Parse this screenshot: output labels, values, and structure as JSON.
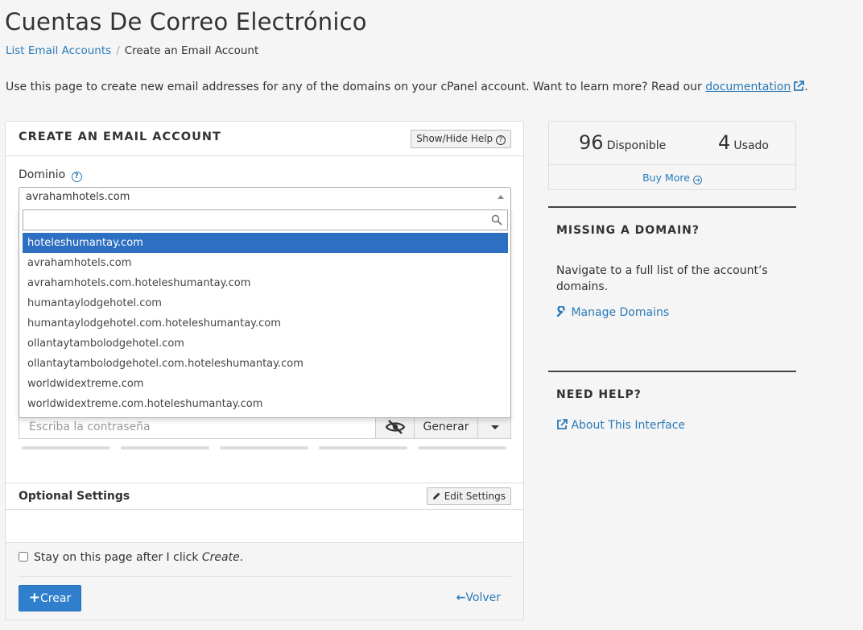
{
  "header": {
    "title": "Cuentas De Correo Electrónico",
    "breadcrumb": {
      "link": "List Email Accounts",
      "separator": "/",
      "current": "Create an Email Account"
    },
    "intro_text": "Use this page to create new email addresses for any of the domains on your cPanel account. Want to learn more? Read our ",
    "intro_link": "documentation",
    "intro_end": "."
  },
  "form": {
    "title": "CREATE AN EMAIL ACCOUNT",
    "help_button": "Show/Hide Help",
    "domain_label": "Dominio",
    "domain_selected": "avrahamhotels.com",
    "dropdown_search_value": "",
    "domain_options": [
      "hoteleshumantay.com",
      "avrahamhotels.com",
      "avrahamhotels.com.hoteleshumantay.com",
      "humantaylodgehotel.com",
      "humantaylodgehotel.com.hoteleshumantay.com",
      "ollantaytambolodgehotel.com",
      "ollantaytambolodgehotel.com.hoteleshumantay.com",
      "worldwidextreme.com",
      "worldwidextreme.com.hoteleshumantay.com"
    ],
    "highlighted_option_index": 0,
    "password_placeholder": "Escriba la contraseña",
    "generate_button": "Generar",
    "optional_title": "Optional Settings",
    "edit_settings_button": "Edit Settings",
    "stay_label": "Stay on this page after I click ",
    "stay_label_em": "Create",
    "stay_label_end": ".",
    "stay_checked": false,
    "create_button": "Crear",
    "back_link": "Volver"
  },
  "stats": {
    "available_count": "96",
    "available_label": "Disponible",
    "used_count": "4",
    "used_label": "Usado",
    "buy_more": "Buy More"
  },
  "sidebar": {
    "missing_title": "MISSING A DOMAIN?",
    "missing_text": "Navigate to a full list of the account’s domains.",
    "manage_domains": "Manage Domains",
    "help_title": "NEED HELP?",
    "about_link": "About This Interface"
  },
  "colors": {
    "link": "#2a7ab8",
    "primary_button": "#2f7fcd",
    "highlight": "#2d6fc0"
  }
}
